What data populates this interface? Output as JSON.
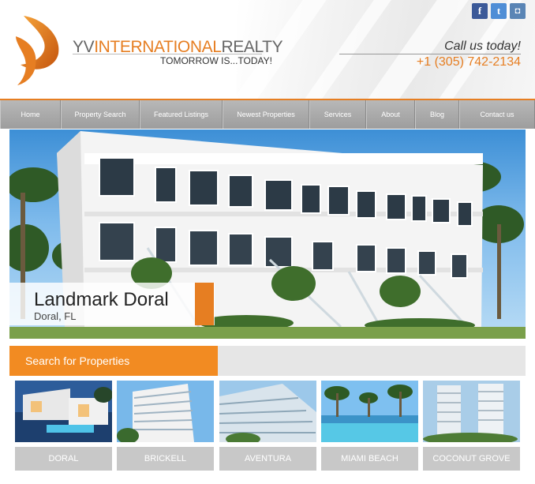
{
  "brand": {
    "name_prefix": "YV",
    "name_mid": "INTERNATIONAL",
    "name_suffix": "REALTY",
    "tagline": "TOMORROW IS...TODAY!",
    "accent_color": "#e67e22"
  },
  "social": [
    {
      "icon": "facebook-icon",
      "glyph": "f",
      "color": "#3b5998"
    },
    {
      "icon": "twitter-icon",
      "glyph": "t",
      "color": "#4f8ed6"
    },
    {
      "icon": "instagram-icon",
      "glyph": "◘",
      "color": "#5a85b5"
    }
  ],
  "contact": {
    "label": "Call us today!",
    "phone": "+1 (305) 742-2134"
  },
  "nav": {
    "items": [
      {
        "label": "Home"
      },
      {
        "label": "Property Search"
      },
      {
        "label": "Featured Listings"
      },
      {
        "label": "Newest Properties"
      },
      {
        "label": "Services"
      },
      {
        "label": "About"
      },
      {
        "label": "Blog"
      },
      {
        "label": "Contact us"
      }
    ]
  },
  "hero": {
    "title": "Landmark Doral",
    "location": "Doral, FL"
  },
  "search": {
    "title": "Search for Properties"
  },
  "areas": [
    {
      "label": "DORAL"
    },
    {
      "label": "BRICKELL"
    },
    {
      "label": "AVENTURA"
    },
    {
      "label": "MIAMI BEACH"
    },
    {
      "label": "COCONUT GROVE"
    }
  ]
}
